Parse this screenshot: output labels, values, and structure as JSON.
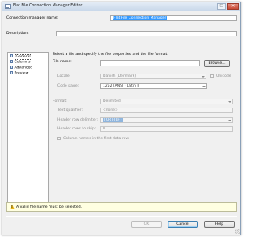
{
  "window": {
    "title": "Flat File Connection Manager Editor",
    "icon": "flat-file-editor-icon",
    "maximize_glyph": "□",
    "close_glyph": "✕"
  },
  "header": {
    "connection_name_label": "Connection manager name:",
    "connection_name_value": "Flat File Connection Manager",
    "description_label": "Description:",
    "description_value": ""
  },
  "nav": {
    "items": [
      {
        "label": "General",
        "selected": true
      },
      {
        "label": "Columns"
      },
      {
        "label": "Advanced"
      },
      {
        "label": "Preview"
      }
    ]
  },
  "general": {
    "instruction": "Select a file and specify the file properties and the file format.",
    "file_name_label": "File name:",
    "file_name_value": "",
    "browse_label": "Browse...",
    "locale_label": "Locale:",
    "locale_value": "Danish (Denmark)",
    "unicode_label": "Unicode",
    "code_page_label": "Code page:",
    "code_page_value": "1252  (ANSI - Latin I)",
    "format_label": "Format:",
    "format_value": "Delimited",
    "text_qualifier_label": "Text qualifier:",
    "text_qualifier_value": "<none>",
    "header_row_delimiter_label": "Header row delimiter:",
    "header_row_delimiter_value": "{CR}{LF}",
    "header_rows_skip_label": "Header rows to skip:",
    "header_rows_skip_value": "0",
    "column_names_label": "Column names in the first data row"
  },
  "status": {
    "warning_text": "A valid file name must be selected.",
    "warning_icon": "warning-icon"
  },
  "buttons": {
    "ok": "OK",
    "cancel": "Cancel",
    "help": "Help"
  },
  "colors": {
    "selection": "#3399ff",
    "warning_bg": "#ffffe1",
    "dialog_bg": "#f0f0f0"
  }
}
